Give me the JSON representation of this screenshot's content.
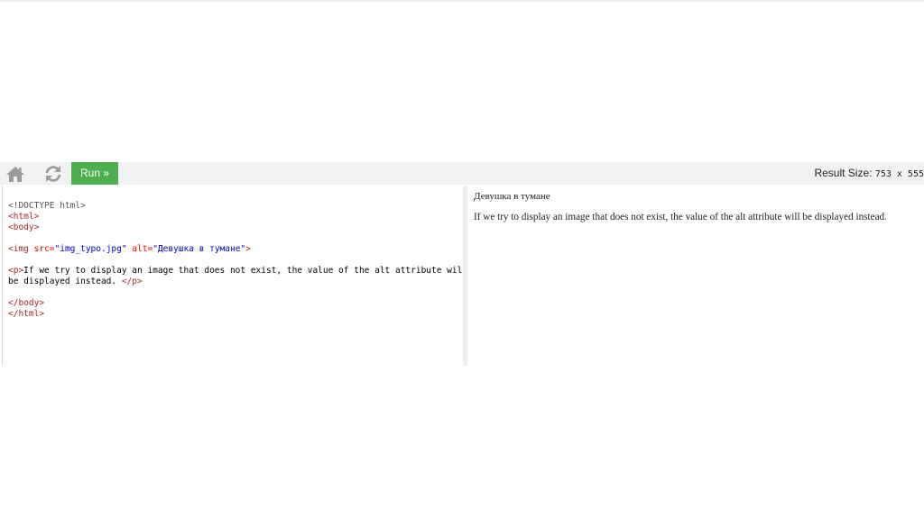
{
  "toolbar": {
    "home_icon": "home-icon",
    "refresh_icon": "refresh-icon",
    "run_label": "Run »",
    "result_size_label": "Result Size:",
    "result_size_value": "753 x 555"
  },
  "code_editor": {
    "lines": {
      "l1": "<!DOCTYPE html>",
      "l2": "<html>",
      "l3": "<body>",
      "l5_open": "<img ",
      "l5_attr1": "src=",
      "l5_val1": "\"img_typo.jpg\"",
      "l5_attr2": " alt=",
      "l5_val2": "\"Девушка в тумане\"",
      "l5_close": ">",
      "l7_open": "<p>",
      "l7_text": "If we try to display an image that does not exist, the value of the alt attribute will",
      "l8_text": "be displayed instead. ",
      "l8_close": "</p>",
      "l10": "</body>",
      "l11": "</html>"
    }
  },
  "result": {
    "img_alt": "Девушка в тумане",
    "paragraph": "If we try to display an image that does not exist, the value of the alt attribute will be displayed instead."
  },
  "colors": {
    "run_button": "#4caf50",
    "toolbar_bg": "#f1f1f1",
    "tag": "#a52a2a",
    "attribute": "#ff0000",
    "attribute_value": "#0000cd"
  }
}
